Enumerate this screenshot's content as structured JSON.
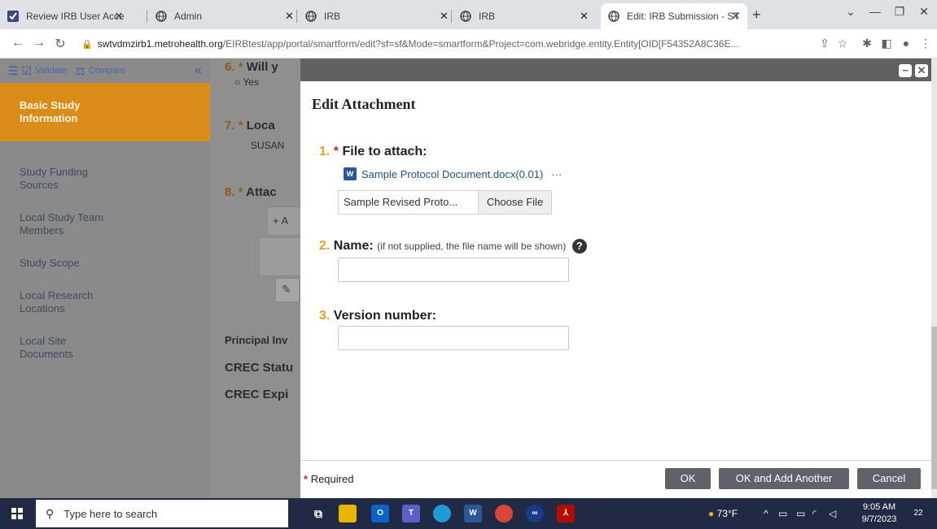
{
  "browser": {
    "tabs": [
      {
        "title": "Review IRB User Access R",
        "icon": "todo-check-icon"
      },
      {
        "title": "Admin",
        "icon": "globe-icon"
      },
      {
        "title": "IRB",
        "icon": "globe-icon"
      },
      {
        "title": "IRB",
        "icon": "globe-icon"
      },
      {
        "title": "Edit: IRB Submission - ST",
        "icon": "globe-icon"
      }
    ],
    "new_tab": "+",
    "close_glyph": "✕",
    "url_host": "swtvdmzirb1.metrohealth.org",
    "url_path": "/EIRBtest/app/portal/smartform/edit?sf=sf&Mode=smartform&Project=com.webridge.entity.Entity[OID[F54352A8C36E..."
  },
  "sidebar": {
    "validate_label": "Validate",
    "compare_label": "Compare",
    "items": [
      "Basic Study Information",
      "Study Funding Sources",
      "Local Study Team Members",
      "Study Scope",
      "Local Research Locations",
      "Local Site Documents"
    ]
  },
  "background": {
    "q6_num": "6.",
    "q6_text": "Will y",
    "q6_option": "Yes",
    "q7_num": "7.",
    "q7_text": "Loca",
    "q7_value": "SUSAN",
    "q8_num": "8.",
    "q8_text": "Attac",
    "add_label": "+ A",
    "principal": "Principal Inv",
    "crec_status": "CREC Statu",
    "crec_exp": "CREC Expi"
  },
  "dialog": {
    "title": "Edit Attachment",
    "field1_num": "1.",
    "field1_label": "File to attach:",
    "current_file": "Sample Protocol Document.docx(0.01)",
    "more_glyph": "···",
    "chosen_file": "Sample Revised Proto...",
    "choose_label": "Choose File",
    "field2_num": "2.",
    "field2_label": "Name:",
    "field2_hint": "(if not supplied, the file name will be shown)",
    "field3_num": "3.",
    "field3_label": "Version number:",
    "required_note": "Required",
    "required_star": "*",
    "ok_label": "OK",
    "ok_add_label": "OK and Add Another",
    "cancel_label": "Cancel"
  },
  "taskbar": {
    "search_placeholder": "Type here to search",
    "weather": "73°F",
    "time": "9:05 AM",
    "date": "9/7/2023",
    "notifications": "22"
  }
}
